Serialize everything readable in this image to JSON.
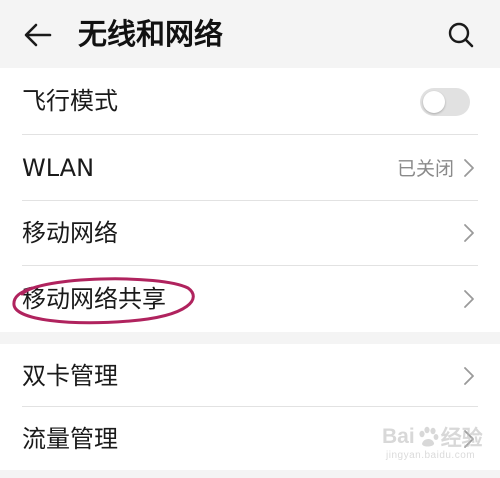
{
  "header": {
    "back_icon": "arrow-left-icon",
    "title": "无线和网络",
    "search_icon": "search-icon"
  },
  "sections": [
    {
      "items": [
        {
          "label": "飞行模式",
          "control": "toggle",
          "toggle_on": false
        },
        {
          "label": "WLAN",
          "value": "已关闭",
          "control": "chevron"
        },
        {
          "label": "移动网络",
          "control": "chevron"
        },
        {
          "label": "移动网络共享",
          "control": "chevron",
          "highlighted": true
        }
      ]
    },
    {
      "items": [
        {
          "label": "双卡管理",
          "control": "chevron"
        },
        {
          "label": "流量管理",
          "control": "chevron"
        }
      ]
    }
  ],
  "annotation": {
    "highlight_color": "#b0235e"
  },
  "watermark": {
    "left_text": "Bai",
    "right_text": "经验",
    "url": "jingyan.baidu.com"
  },
  "colors": {
    "background": "#f4f4f4",
    "card": "#ffffff",
    "secondary_text": "#8a8a8a",
    "toggle_off": "#e1e1e1"
  }
}
